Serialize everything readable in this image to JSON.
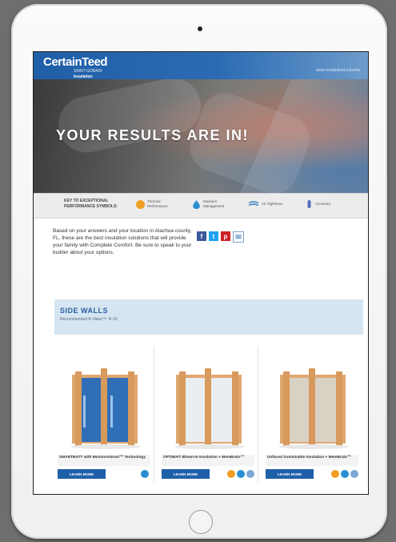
{
  "header": {
    "brand": "CertainTeed",
    "brand_sub": "SAINT-GOBAIN",
    "division": "Insulation",
    "top_link": "www.certainteed.com/ins"
  },
  "hero": {
    "title": "YOUR RESULTS ARE IN!"
  },
  "key": {
    "title": "KEY TO EXCEPTIONAL PERFORMANCE SYMBOLS:",
    "items": [
      {
        "label": "Thermal Performance",
        "icon": "thermal-icon",
        "color": "#f0a020"
      },
      {
        "label": "Moisture Management",
        "icon": "moisture-icon",
        "color": "#2a8fd0"
      },
      {
        "label": "Air-Tightness",
        "icon": "air-icon",
        "color": "#3a7fc0"
      },
      {
        "label": "Acoustics",
        "icon": "acoustics-icon",
        "color": "#5a6fb8"
      }
    ]
  },
  "intro": {
    "text": "Based on your answers and your location in Alachua county, FL, these are the best insulation solutions that will provide your family with Complete Comfort. Be sure to speak to your builder about your options."
  },
  "share": {
    "facebook": "f",
    "twitter": "t",
    "pinterest": "p",
    "email": "✉"
  },
  "section": {
    "title": "SIDE WALLS",
    "subtitle": "Recommended R-Value™: R-15"
  },
  "products": [
    {
      "name": "SMARTBATT with MoistureSmart™ Technology",
      "learn": "LEARN MORE"
    },
    {
      "name": "OPTIMA® Blown-In Insulation + MemBrain™",
      "learn": "LEARN MORE"
    },
    {
      "name": "Unfaced Sustainable Insulation + MemBrain™",
      "learn": "LEARN MORE"
    }
  ],
  "colors": {
    "brand_blue": "#1f5fa8",
    "banner_blue": "#d5e5f2"
  }
}
